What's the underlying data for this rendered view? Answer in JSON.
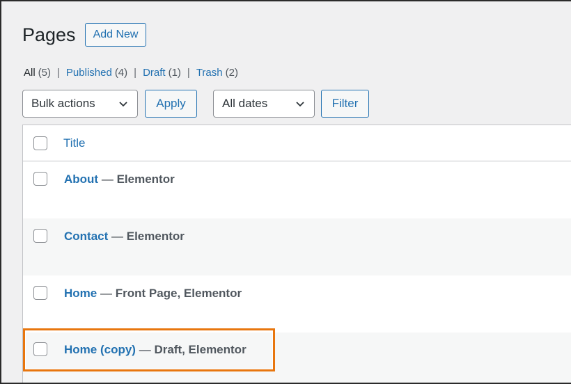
{
  "header": {
    "title": "Pages",
    "add_new_label": "Add New"
  },
  "filters": [
    {
      "label": "All",
      "count": "(5)",
      "current": true
    },
    {
      "label": "Published",
      "count": "(4)",
      "current": false
    },
    {
      "label": "Draft",
      "count": "(1)",
      "current": false
    },
    {
      "label": "Trash",
      "count": "(2)",
      "current": false
    }
  ],
  "separator": "|",
  "tablenav": {
    "bulk_actions_value": "Bulk actions",
    "apply_label": "Apply",
    "dates_value": "All dates",
    "filter_label": "Filter"
  },
  "table": {
    "column_title": "Title",
    "rows": [
      {
        "name": "About",
        "state": "Elementor"
      },
      {
        "name": "Contact",
        "state": "Elementor"
      },
      {
        "name": "Home",
        "state": "Front Page, Elementor"
      },
      {
        "name": "Home (copy)",
        "state": "Draft, Elementor"
      }
    ],
    "dash": "—"
  },
  "colors": {
    "accent": "#2271b1",
    "highlight": "#e8760e"
  }
}
